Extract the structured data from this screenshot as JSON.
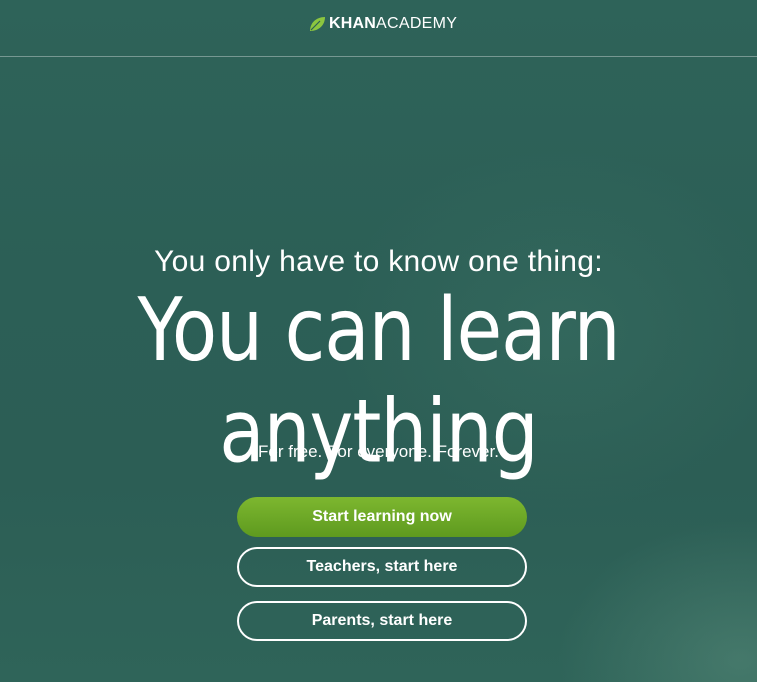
{
  "header": {
    "logo_bold": "KHAN",
    "logo_light": "ACADEMY",
    "logo_icon": "leaf-icon"
  },
  "hero": {
    "tagline": "You only have to know one thing:",
    "headline": "You can learn anything",
    "subline": "For free. For everyone. Forever."
  },
  "buttons": {
    "start": "Start learning now",
    "teachers": "Teachers, start here",
    "parents": "Parents, start here"
  },
  "colors": {
    "background": "#2c5f56",
    "primary_button": "#6aa826",
    "leaf": "#8cc63f",
    "text": "#ffffff"
  }
}
